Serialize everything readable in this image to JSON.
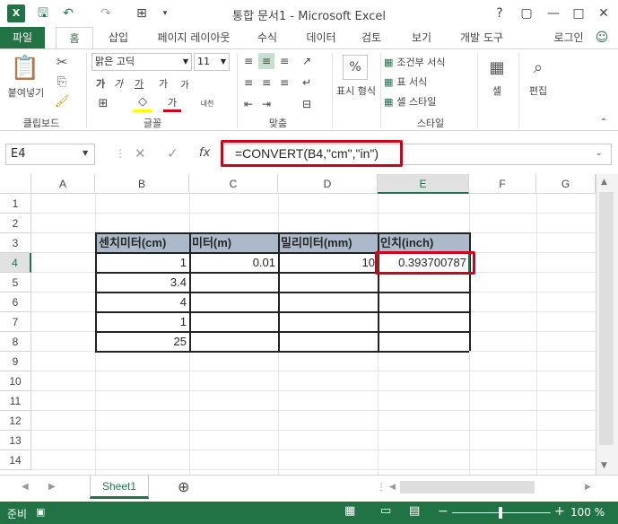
{
  "title": "통합 문서1 - Microsoft Excel",
  "window_controls": {
    "help": "?",
    "restore": "▢",
    "minimize": "—",
    "maximize": "□",
    "close": "✕"
  },
  "tabs": [
    "파일",
    "홈",
    "삽입",
    "페이지 레이아웃",
    "수식",
    "데이터",
    "검토",
    "보기",
    "개발 도구"
  ],
  "user": "로그인",
  "ribbon": {
    "paste": "붙여넣기",
    "font_name": "맑은 고딕",
    "font_size": "11",
    "percent": "%",
    "display_format": "표시 형식",
    "conditional_format": "조건부 서식",
    "table_format": "표 서식",
    "cell_style": "셀 스타일",
    "cells": "셀",
    "editing": "편집",
    "groups": [
      "클립보드",
      "글꼴",
      "맞춤",
      "스타일"
    ]
  },
  "formula_bar": {
    "name_box": "E4",
    "fx": "fx",
    "formula": "=CONVERT(B4,\"cm\",\"in\")"
  },
  "columns": [
    "A",
    "B",
    "C",
    "D",
    "E",
    "F",
    "G"
  ],
  "rows": [
    "1",
    "2",
    "3",
    "4",
    "5",
    "6",
    "7",
    "8",
    "9",
    "10",
    "11",
    "12",
    "13",
    "14"
  ],
  "table": {
    "headers": [
      "센치미터(cm)",
      "미터(m)",
      "밀리미터(mm)",
      "인치(inch)"
    ],
    "b_values": [
      "1",
      "3.4",
      "4",
      "1",
      "25"
    ],
    "c4": "0.01",
    "d4": "10",
    "e4": "0.393700787"
  },
  "sheet_tab": "Sheet1",
  "add_sheet": "⊕",
  "status": {
    "ready": "준비",
    "zoom": "100 %",
    "minus": "−",
    "plus": "+"
  },
  "colors": {
    "excel_green": "#217346",
    "header_fill": "#acb9ca",
    "highlight_red": "#d0021b"
  }
}
